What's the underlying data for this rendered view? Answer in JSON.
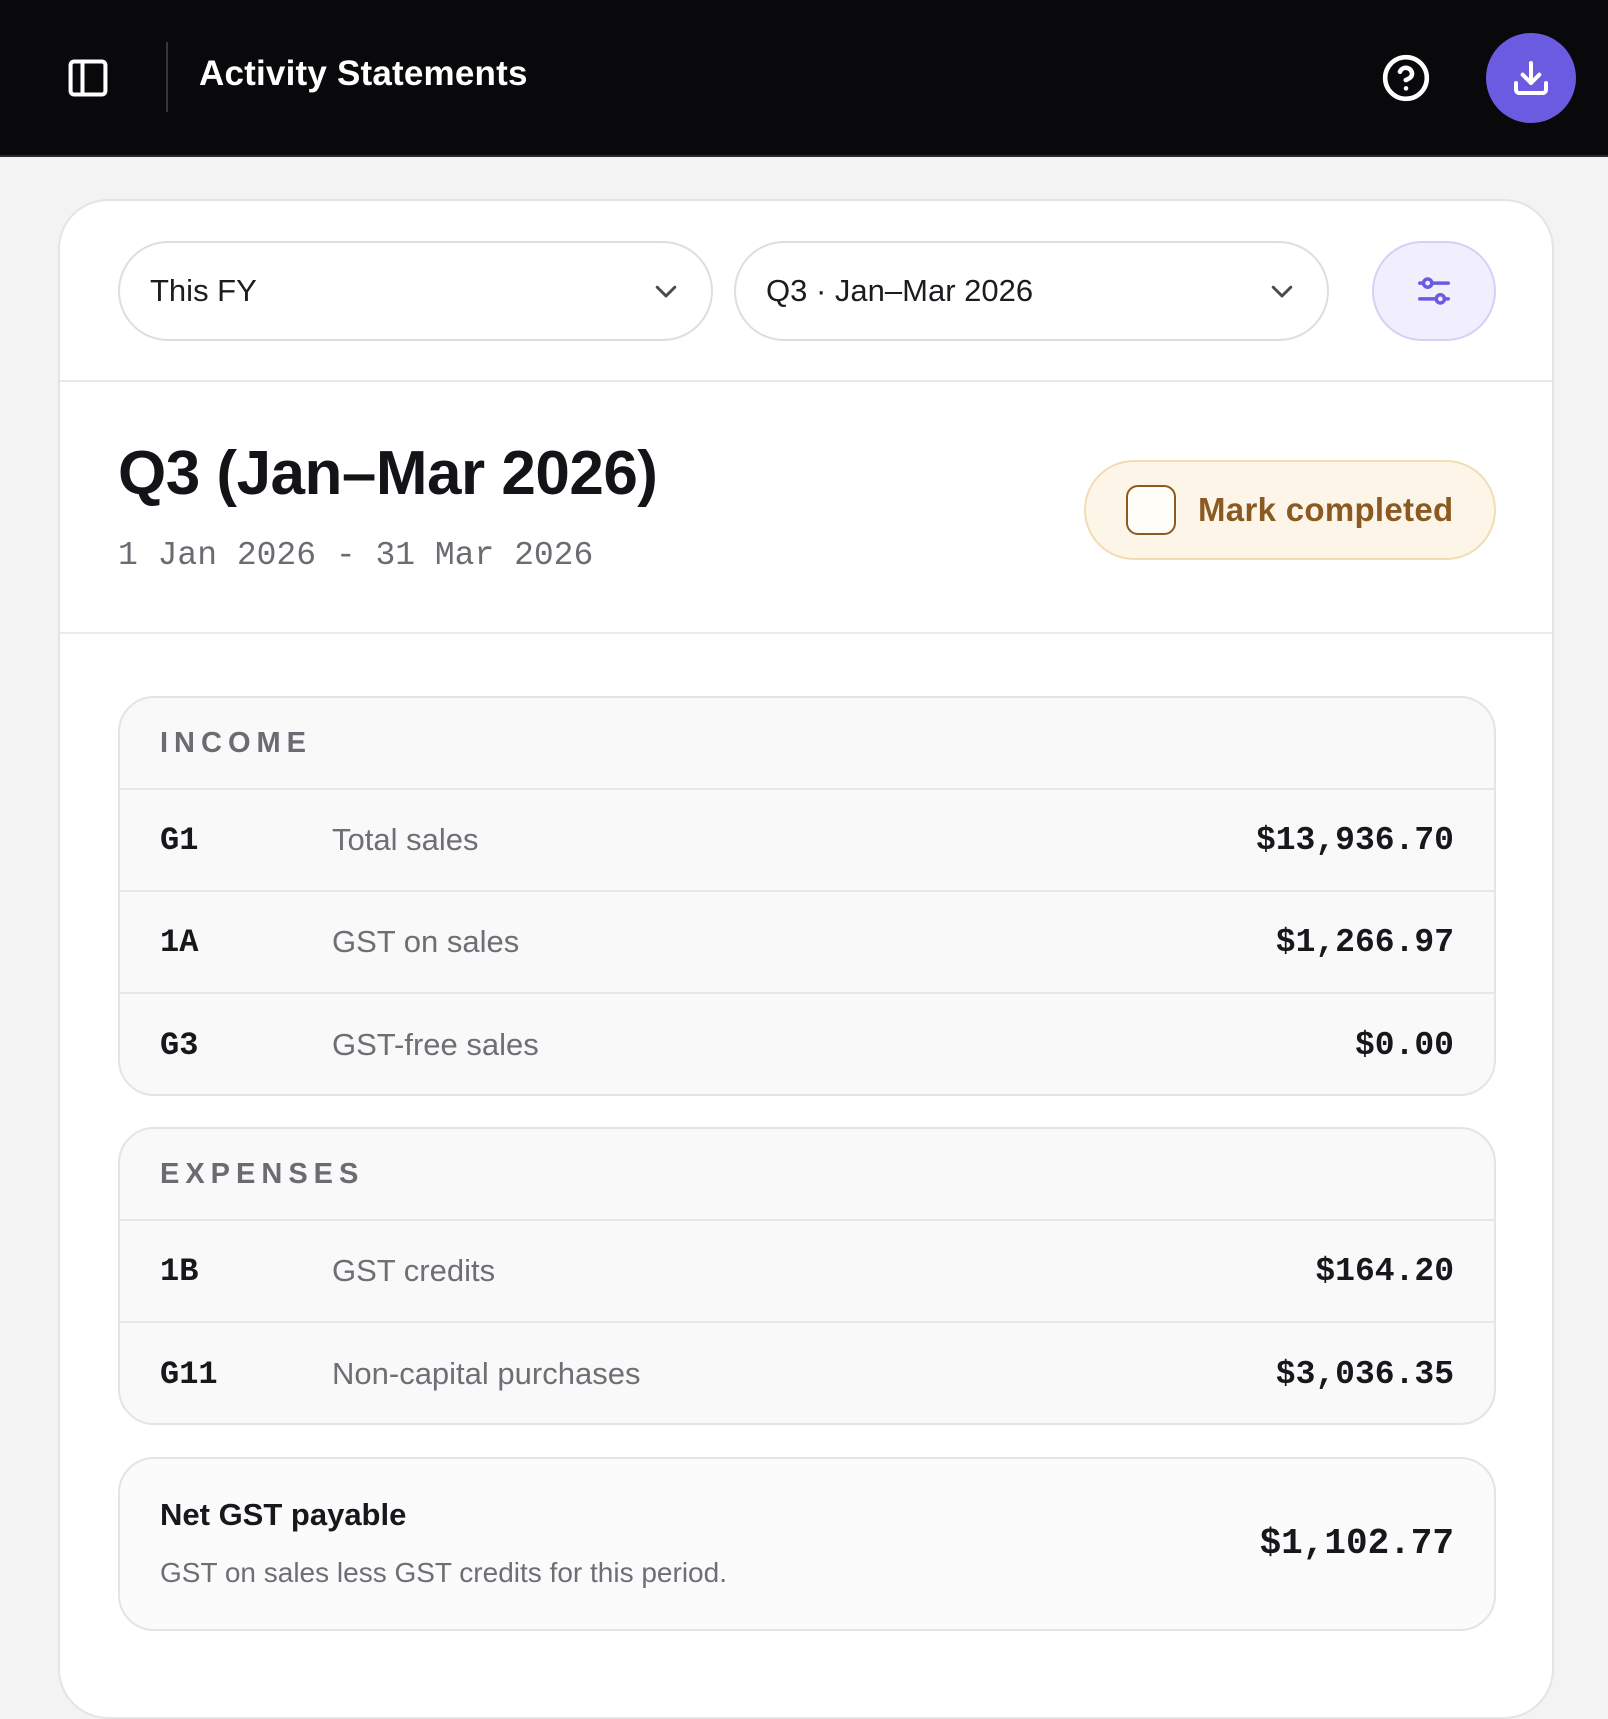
{
  "header": {
    "title": "Activity Statements",
    "icons": {
      "sidebar": "sidebar-toggle-icon",
      "help": "help-circle-icon",
      "download": "download-icon"
    },
    "accent_color": "#6b5be0"
  },
  "filters": {
    "year_value": "This FY",
    "quarter_value": "Q3 · Jan–Mar 2026"
  },
  "period": {
    "title": "Q3 (Jan–Mar 2026)",
    "range": "1 Jan 2026 - 31 Mar 2026",
    "mark_completed_label": "Mark completed",
    "completed": false
  },
  "income": {
    "heading": "INCOME",
    "rows": [
      {
        "code": "G1",
        "label": "Total sales",
        "amount": "$13,936.70"
      },
      {
        "code": "1A",
        "label": "GST on sales",
        "amount": "$1,266.97"
      },
      {
        "code": "G3",
        "label": "GST-free sales",
        "amount": "$0.00"
      }
    ]
  },
  "expenses": {
    "heading": "EXPENSES",
    "rows": [
      {
        "code": "1B",
        "label": "GST credits",
        "amount": "$164.20"
      },
      {
        "code": "G11",
        "label": "Non-capital purchases",
        "amount": "$3,036.35"
      }
    ]
  },
  "net": {
    "title": "Net GST payable",
    "description": "GST on sales less GST credits for this period.",
    "amount": "$1,102.77"
  }
}
